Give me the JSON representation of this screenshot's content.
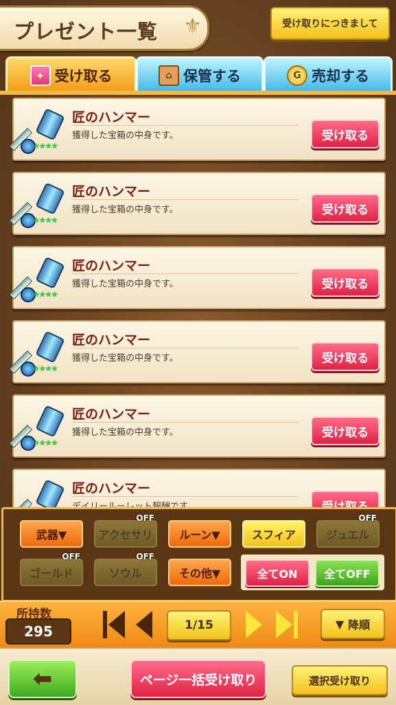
{
  "header": {
    "title": "プレゼント一覧",
    "info_button": "受け取りにつきまして"
  },
  "tabs": [
    {
      "label": "受け取る",
      "icon": "gift-icon",
      "active": true
    },
    {
      "label": "保管する",
      "icon": "house-icon",
      "active": false
    },
    {
      "label": "売却する",
      "icon": "coin-icon",
      "active": false
    }
  ],
  "items": [
    {
      "name": "匠のハンマー",
      "desc": "獲得した宝箱の中身です。",
      "button": "受け取る",
      "stars": "★★★★"
    },
    {
      "name": "匠のハンマー",
      "desc": "獲得した宝箱の中身です。",
      "button": "受け取る",
      "stars": "★★★★"
    },
    {
      "name": "匠のハンマー",
      "desc": "獲得した宝箱の中身です。",
      "button": "受け取る",
      "stars": "★★★★"
    },
    {
      "name": "匠のハンマー",
      "desc": "獲得した宝箱の中身です。",
      "button": "受け取る",
      "stars": "★★★★"
    },
    {
      "name": "匠のハンマー",
      "desc": "獲得した宝箱の中身です。",
      "button": "受け取る",
      "stars": "★★★★"
    },
    {
      "name": "匠のハンマー",
      "desc": "デイリールーレット報酬です。",
      "button": "受け取る",
      "stars": "★★★★"
    }
  ],
  "filters": {
    "weapon": "武器▼",
    "accessory": "アクセサリ",
    "rune": "ルーン▼",
    "sphere": "スフィア",
    "jewel": "ジュエル",
    "gold": "ゴールド",
    "soul": "ソウル",
    "other": "その他▼",
    "off_tag": "OFF",
    "all_on": "全てON",
    "all_off": "全てOFF"
  },
  "pager": {
    "count_label": "所持数",
    "count": "295",
    "page": "1/15",
    "sort": "降順",
    "sort_icon": "▼"
  },
  "footer": {
    "back_icon": "left-arrow-icon",
    "page_receive": "ページ一括受け取り",
    "select_receive": "選択受け取り"
  }
}
